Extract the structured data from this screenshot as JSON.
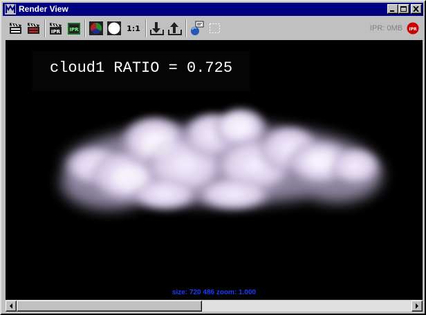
{
  "window": {
    "title": "Render View",
    "controls": [
      "minimize-icon",
      "maximize-icon",
      "close-icon"
    ]
  },
  "toolbar": {
    "buttons": [
      "render-clapper-icon",
      "redo-render-icon",
      "ipr-render-icon",
      "ipr-refresh-icon",
      "color-channel-icon",
      "alpha-channel-icon",
      "one-to-one-icon",
      "keep-image-icon",
      "remove-image-icon",
      "render-globals-icon",
      "region-select-icon"
    ],
    "one_to_one_label": "1:1",
    "ipr_label": "IPR",
    "ipr_memory": "IPR: 0MB",
    "ipr_stop_label": "IPR"
  },
  "viewport": {
    "overlay_text": "cloud1 RATIO = 0.725",
    "status_text": "size:  720  486 zoom: 1.000",
    "background": "#000000",
    "cloud_color": "#e6dcf2"
  },
  "scrollbar": {
    "position": 0.47
  },
  "colors": {
    "titlebar": "#000080",
    "status_text": "#1a3cff",
    "ipr_stop": "#cc0000"
  }
}
